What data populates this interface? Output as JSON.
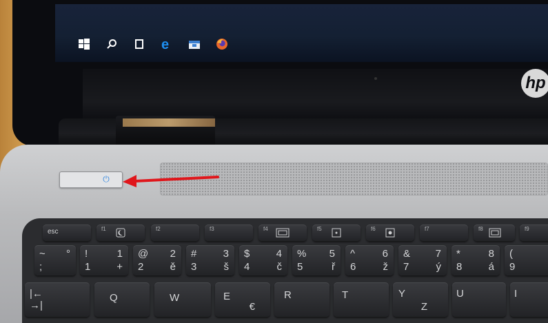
{
  "taskbar": {
    "icons": [
      "windows-start-icon",
      "search-icon",
      "task-view-icon",
      "edge-browser-icon",
      "file-explorer-icon",
      "firefox-icon"
    ]
  },
  "brand": {
    "logo": "hp"
  },
  "power_button": {
    "glyph": "⏻"
  },
  "annotation": {
    "arrow_color": "#e0161b"
  },
  "keyboard": {
    "fn_row": [
      {
        "label": "esc",
        "fn": ""
      },
      {
        "label": "",
        "fn": "f1"
      },
      {
        "label": "",
        "fn": "f2"
      },
      {
        "label": "",
        "fn": "f3"
      },
      {
        "label": "",
        "fn": "f4"
      },
      {
        "label": "",
        "fn": "f5"
      },
      {
        "label": "",
        "fn": "f6"
      },
      {
        "label": "",
        "fn": "f7"
      },
      {
        "label": "",
        "fn": "f8"
      },
      {
        "label": "",
        "fn": "f9"
      }
    ],
    "num_row": [
      {
        "tl": "~",
        "tr": "°",
        "bl": ";",
        "br": ""
      },
      {
        "tl": "!",
        "tr": "1",
        "bl": "1",
        "br": "+"
      },
      {
        "tl": "@",
        "tr": "2",
        "bl": "2",
        "br": "ě"
      },
      {
        "tl": "#",
        "tr": "3",
        "bl": "3",
        "br": "š"
      },
      {
        "tl": "$",
        "tr": "4",
        "bl": "4",
        "br": "č"
      },
      {
        "tl": "%",
        "tr": "5",
        "bl": "5",
        "br": "ř"
      },
      {
        "tl": "^",
        "tr": "6",
        "bl": "6",
        "br": "ž"
      },
      {
        "tl": "&",
        "tr": "7",
        "bl": "7",
        "br": "ý"
      },
      {
        "tl": "*",
        "tr": "8",
        "bl": "8",
        "br": "á"
      },
      {
        "tl": "(",
        "tr": "",
        "bl": "9",
        "br": ""
      }
    ],
    "qwerty_row": [
      {
        "tl": "|←",
        "bl": "→|"
      },
      {
        "tl": "Q",
        "bl": ""
      },
      {
        "tl": "W",
        "bl": ""
      },
      {
        "tl": "E",
        "bl": "€"
      },
      {
        "tl": "R",
        "bl": ""
      },
      {
        "tl": "T",
        "bl": ""
      },
      {
        "tl": "Y",
        "bl": "Z"
      },
      {
        "tl": "U",
        "bl": ""
      },
      {
        "tl": "I",
        "bl": ""
      }
    ]
  }
}
